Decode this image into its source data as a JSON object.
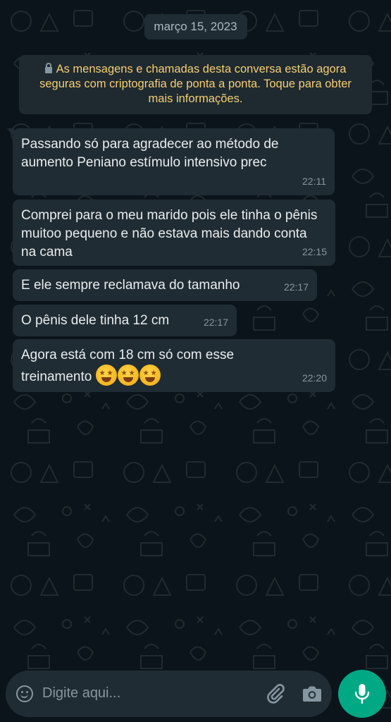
{
  "chat": {
    "date_label": "março 15, 2023",
    "encryption_notice": "As mensagens e chamadas desta conversa estão agora seguras com criptografia de ponta a ponta. Toque para obter mais informações.",
    "messages": [
      {
        "text": "Passando só para agradecer ao método de aumento Peniano estímulo intensivo prec",
        "time": "22:11"
      },
      {
        "text": "Comprei para o meu marido pois ele tinha o pênis muitoo pequeno e não estava mais dando conta na cama",
        "time": "22:15"
      },
      {
        "text": "E ele sempre reclamava do tamanho",
        "time": "22:17"
      },
      {
        "text": "O pênis dele tinha 12 cm",
        "time": "22:17"
      },
      {
        "text": "Agora está com 18 cm só com esse treinamento",
        "time": "22:20",
        "emojis": [
          "star-struck-emoji",
          "star-struck-emoji",
          "star-struck-emoji"
        ]
      }
    ]
  },
  "composer": {
    "placeholder": "Digite aqui...",
    "icons": [
      "emoji-icon",
      "paperclip-icon",
      "camera-icon",
      "microphone-icon"
    ]
  },
  "colors": {
    "background": "#0b141a",
    "bubble": "#202c33",
    "notice_text": "#f7cd73",
    "accent": "#00a884"
  }
}
